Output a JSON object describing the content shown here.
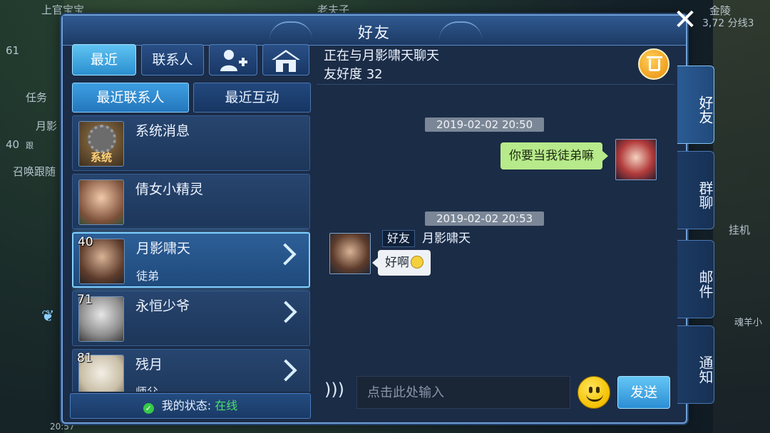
{
  "window": {
    "title": "好友",
    "close_label": "✕"
  },
  "background": {
    "top_left_name": "上官宝宝",
    "top_center_name": "老夫子",
    "top_right_location": "金陵",
    "top_right_coords": "3,72 分线3",
    "left_task_label": "任务",
    "left_player_name": "月影",
    "left_level": "40",
    "left_follow": "跟",
    "left_summon": "召唤跟随",
    "right_idle_label": "挂机",
    "right_skill_label": "魂羊小",
    "bottom_time": "20:57",
    "left_top_level": "61"
  },
  "tabs": {
    "recent": "最近",
    "contacts": "联系人",
    "add_friend_icon": "add-friend-icon",
    "home_icon": "home-icon"
  },
  "subtabs": {
    "recent_contacts": "最近联系人",
    "recent_interactions": "最近互动"
  },
  "contacts": [
    {
      "level": "",
      "name": "系统消息",
      "relation": "",
      "avatar_text": "系统",
      "selected": false,
      "has_chevron": false
    },
    {
      "level": "",
      "name": "倩女小精灵",
      "relation": "",
      "avatar_text": "",
      "selected": false,
      "has_chevron": false
    },
    {
      "level": "40",
      "name": "月影啸天",
      "relation": "徒弟",
      "avatar_text": "",
      "selected": true,
      "has_chevron": true
    },
    {
      "level": "71",
      "name": "永恒少爷",
      "relation": "",
      "avatar_text": "",
      "selected": false,
      "has_chevron": true
    },
    {
      "level": "81",
      "name": "残月",
      "relation": "师父",
      "avatar_text": "",
      "selected": false,
      "has_chevron": true
    }
  ],
  "status": {
    "label": "我的状态:",
    "value": "在线"
  },
  "chat": {
    "header": "正在与月影啸天聊天",
    "friendship": "友好度 32",
    "messages": [
      {
        "time": "2019-02-02 20:50",
        "from": "me",
        "text": "你要当我徒弟嘛"
      },
      {
        "time": "2019-02-02 20:53",
        "from": "friend",
        "tag": "好友",
        "name": "月影啸天",
        "text": "好啊"
      }
    ],
    "input_placeholder": "点击此处输入",
    "send_label": "发送"
  },
  "side_tabs": [
    {
      "label": "好友",
      "active": true
    },
    {
      "label": "群聊",
      "active": false
    },
    {
      "label": "邮件",
      "active": false
    },
    {
      "label": "通知",
      "active": false
    }
  ],
  "colors": {
    "panel_bg": "#1b2c47",
    "accent": "#5fc3f2",
    "my_bubble": "#b7ea8a",
    "online": "#4be06a"
  }
}
